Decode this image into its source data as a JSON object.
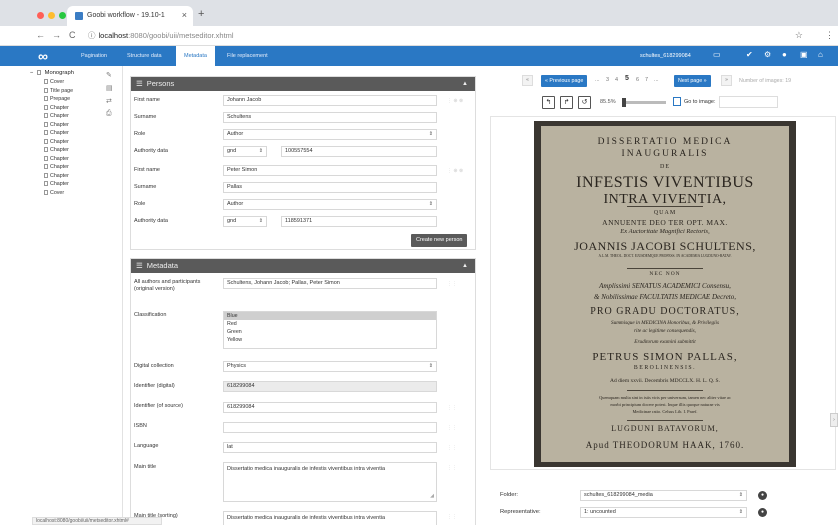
{
  "browser": {
    "tab_title": "Goobi workflow - 19.10-1",
    "tab_close": "×",
    "new_tab": "+",
    "back": "←",
    "forward": "→",
    "reload": "C",
    "secure_icon": "ⓘ",
    "url_host": "localhost",
    "url_path": ":8080/goobi/uii/metseditor.xhtml",
    "star": "☆",
    "menu": "⋮",
    "light_colors": [
      "#ff5f57",
      "#febc2e",
      "#28c840"
    ],
    "status_text": "localhost:8080/goobi/uii/metseditor.xhtml#"
  },
  "app": {
    "accent": "#2a78c4",
    "logo": "∞",
    "tabs": [
      {
        "label": "Pagination"
      },
      {
        "label": "Structure data"
      },
      {
        "label": "Metadata",
        "active": true
      },
      {
        "label": "File replacement"
      }
    ],
    "process_id": "schultes_618299084",
    "icons": [
      "image-link-icon",
      "check-icon",
      "gear-icon",
      "circle-icon",
      "save-icon",
      "home-icon"
    ],
    "icon_glyphs": [
      "▭",
      "✔",
      "⚙",
      "●",
      "▣",
      "⌂"
    ]
  },
  "tree": {
    "root": "Monograph",
    "expander": "−",
    "items": [
      "Cover",
      "Title page",
      "Prepage",
      "Chapter",
      "Chapter",
      "Chapter",
      "Chapter",
      "Chapter",
      "Chapter",
      "Chapter",
      "Chapter",
      "Chapter",
      "Chapter",
      "Cover"
    ],
    "tool_glyphs": [
      "✎",
      "▤",
      "⇄",
      "⎙"
    ]
  },
  "persons": {
    "title": "Persons",
    "caret": "▲",
    "hamburger": "☰",
    "labels": {
      "first_name": "First name",
      "surname": "Surname",
      "role": "Role",
      "authority": "Authority data"
    },
    "entries": [
      {
        "first_name": "Johann Jacob",
        "surname": "Schultens",
        "role": "Author",
        "auth_source": "gnd",
        "auth_id": "100557554"
      },
      {
        "first_name": "Peter Simon",
        "surname": "Pallas",
        "role": "Author",
        "auth_source": "gnd",
        "auth_id": "118591371"
      }
    ],
    "create_button": "Create new person",
    "row_icons": "⋮ ⊕ ⊗"
  },
  "metadata": {
    "title": "Metadata",
    "caret": "▲",
    "hamburger": "☰",
    "rows": {
      "authors": {
        "label": "All authors and participants (original version)",
        "value": "Schultens, Johann Jacob; Pallas, Peter Simon"
      },
      "classification": {
        "label": "Classification",
        "options": [
          "Blue",
          "Red",
          "Green",
          "Yellow"
        ],
        "selected": "Blue"
      },
      "digital_collection": {
        "label": "Digital collection",
        "value": "Physics"
      },
      "identifier_digital": {
        "label": "Identifier (digital)",
        "value": "618299084"
      },
      "identifier_source": {
        "label": "Identifier (of source)",
        "value": "618299084"
      },
      "isbn": {
        "label": "ISBN",
        "value": ""
      },
      "language": {
        "label": "Language",
        "value": "lat"
      },
      "main_title": {
        "label": "Main title",
        "value": "Dissertatio medica inauguralis de infestis viventibus intra viventia"
      },
      "main_title_sorting": {
        "label": "Main title (sorting)",
        "value": "Dissertatio medica inauguralis de infestis viventibus intra viventia"
      }
    },
    "row_icon": "⋮⋮"
  },
  "viewer": {
    "prev_label": "« Previous page",
    "next_label": "Next page »",
    "first_glyph": "«",
    "last_glyph": "»",
    "ellipsis_left": "...",
    "ellipsis_right": "...",
    "pages": [
      "3",
      "4",
      "5",
      "6",
      "7"
    ],
    "current_page": "5",
    "count_label": "Number of images: 19",
    "rotate_left": "↰",
    "rotate_right": "↱",
    "reset": "↺",
    "zoom": "85.5%",
    "zoom_fraction": 0.0,
    "goto_label": "Go to image:",
    "goto_value": "",
    "folder_label": "Folder:",
    "folder_value": "schultes_618299084_media",
    "representative_label": "Representative:",
    "representative_value": "1: uncounted",
    "ok_glyph": "●",
    "edge_glyph": "›"
  },
  "scan_page": {
    "lines": [
      "DISSERTATIO MEDICA",
      "INAUGURALIS",
      "DE",
      "INFESTIS VIVENTIBUS",
      "INTRA VIVENTIA,",
      "QUAM",
      "ANNUENTE DEO TER OPT. MAX.",
      "Ex Auctoritate Magnifici Rectoris,",
      "JOANNIS JACOBI SCHULTENS,",
      "A.L.M. THEOL. DOCT. EJUSDEMQUE PROFESS. IN ACADEMIA LUGDUNO-BATAV.",
      "NEC NON",
      "Amplissimi SENATUS ACADEMICI Consensu,",
      "& Nobilissimae FACULTATIS MEDICAE Decreto,",
      "PRO GRADU DOCTORATUS,",
      "Summisque in MEDICINA Honoribus, & Privilegiis",
      "rite ac legitime consequendis,",
      "Eruditorum examini submittit",
      "PETRUS SIMON PALLAS,",
      "BEROLINENSIS.",
      "Ad diem xxvii. Decembris MDCCLX. H. L. Q. S.",
      "Quemquam multa sint in istis viris per universum, tamen nec aliter vitae ac",
      "morbi principium docere potest. Inque illis quoque naturae vis",
      "Medicinae ratio. Celsus Lib. I. Praef.",
      "LUGDUNI BATAVORUM,",
      "Apud THEODORUM HAAK, 1760."
    ]
  }
}
